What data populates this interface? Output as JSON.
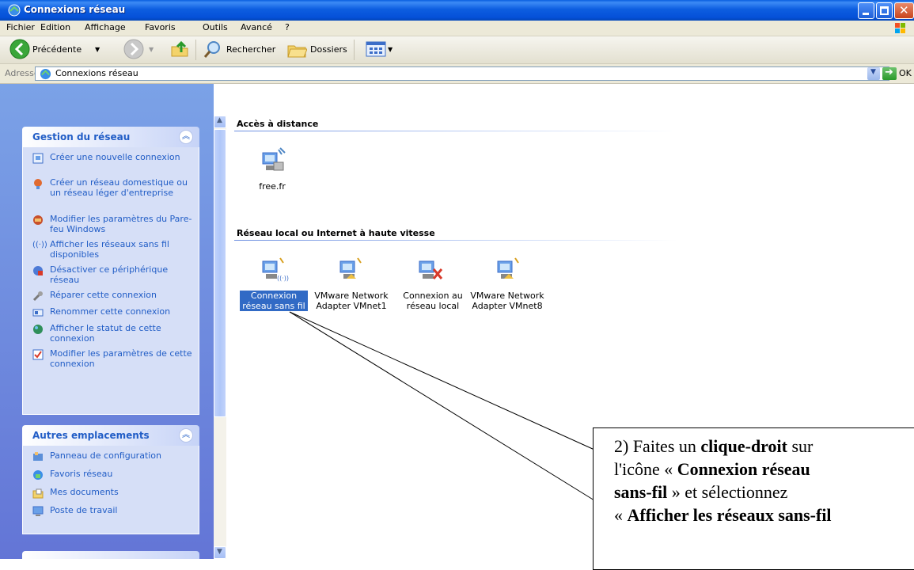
{
  "window": {
    "title": "Connexions réseau"
  },
  "menubar": {
    "items": [
      "Fichier",
      "Edition",
      "Affichage",
      "Favoris",
      "Outils",
      "Avancé",
      "?"
    ]
  },
  "toolbar": {
    "back_label": "Précédente",
    "search_label": "Rechercher",
    "folders_label": "Dossiers"
  },
  "address": {
    "label": "Adresse",
    "value": "Connexions réseau",
    "go_label": "OK"
  },
  "panels": {
    "network_tasks": {
      "title": "Gestion du réseau",
      "items": [
        "Créer une nouvelle connexion",
        "Créer un réseau domestique ou un réseau léger d'entreprise",
        "Modifier les paramètres du Pare-feu Windows",
        "Afficher les réseaux sans fil disponibles",
        "Désactiver ce périphérique réseau",
        "Réparer cette connexion",
        "Renommer cette connexion",
        "Afficher le statut de cette connexion",
        "Modifier les paramètres de cette connexion"
      ]
    },
    "other_places": {
      "title": "Autres emplacements",
      "items": [
        "Panneau de configuration",
        "Favoris réseau",
        "Mes documents",
        "Poste de travail"
      ]
    }
  },
  "groups": {
    "remote": {
      "title": "Accès à distance",
      "items": [
        "free.fr"
      ]
    },
    "lan": {
      "title": "Réseau local ou Internet à haute vitesse",
      "items": [
        "Connexion réseau sans fil",
        "VMware Network Adapter VMnet1",
        "Connexion au réseau local",
        "VMware Network Adapter VMnet8"
      ]
    }
  },
  "annotation": {
    "lines": [
      "2) Faites un ",
      "clique-droit",
      " sur",
      "l'icône « ",
      "Connexion réseau",
      "sans-fil",
      " » et sélectionnez",
      "« ",
      "Afficher les réseaux sans-fil"
    ]
  },
  "colors": {
    "title_bar": "#0a5fe0",
    "task_pane": "#7ba2e7",
    "task_text": "#215dc6",
    "selection": "#316ac5"
  }
}
